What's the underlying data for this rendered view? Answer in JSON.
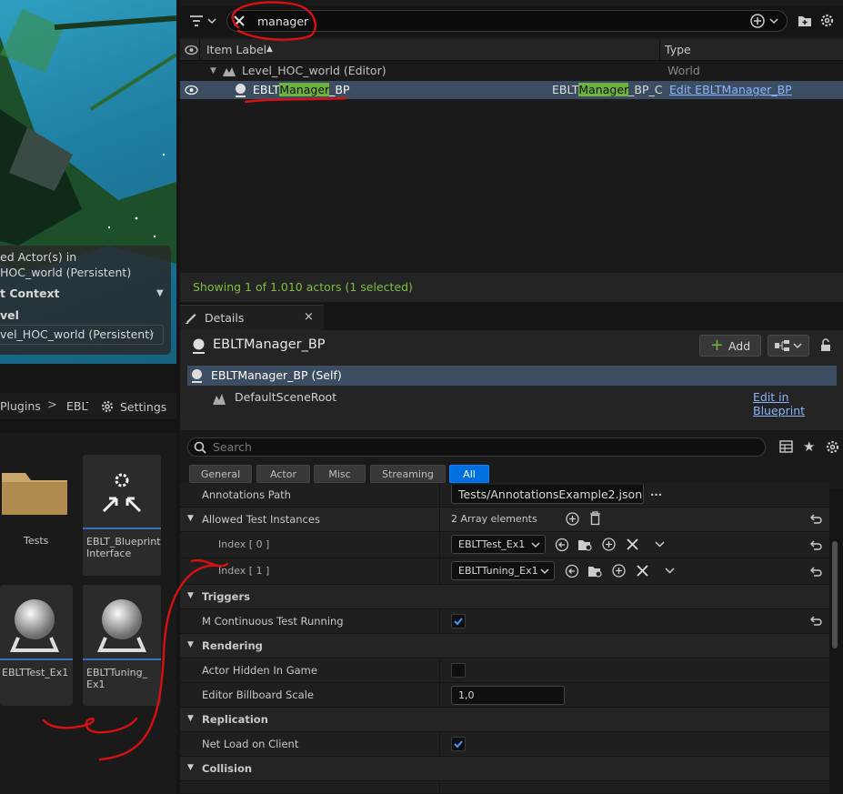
{
  "viewport": {
    "overlay_lines": [
      "ed Actor(s) in",
      "HOC_world (Persistent)",
      "t Context",
      "vel",
      "vel_HOC_world (Persistent)"
    ]
  },
  "content_browser": {
    "breadcrumb": [
      "Plugins",
      "EBLT"
    ],
    "settings_label": "Settings",
    "tiles": [
      {
        "label": "Tests",
        "icon": "folder-icon"
      },
      {
        "label": "EBLT_Blueprint Interface",
        "icon": "blueprint-interface-icon"
      },
      {
        "label": "EBLTTest_Ex1",
        "icon": "sphere-actor-icon"
      },
      {
        "label": "EBLTTuning_ Ex1",
        "icon": "sphere-actor-icon"
      }
    ]
  },
  "outliner": {
    "search_value": "manager",
    "columns": {
      "label": "Item Label",
      "type": "Type"
    },
    "rows": [
      {
        "label": "Level_HOC_world (Editor)",
        "type": "World"
      },
      {
        "label_pre": "EBLT",
        "label_hl": "Manager",
        "label_post": "_BP",
        "class_pre": "EBLT",
        "class_hl": "Manager",
        "class_post": "_BP_C",
        "type_link": "Edit EBLTManager_BP",
        "selected": true
      }
    ],
    "status": "Showing 1 of 1.010 actors (1 selected)",
    "highlight_color": "#6db33f"
  },
  "details": {
    "tab_label": "Details",
    "actor_name": "EBLTManager_BP",
    "add_label": "Add",
    "components": [
      {
        "label": "EBLTManager_BP (Self)",
        "selected": true
      },
      {
        "label": "DefaultSceneRoot"
      }
    ],
    "edit_blueprint_link": "Edit in Blueprint",
    "search_placeholder": "Search",
    "filters": [
      "General",
      "Actor",
      "Misc",
      "Streaming",
      "All"
    ],
    "active_filter": "All",
    "properties": {
      "annotations_path_label": "Annotations Path",
      "annotations_path_value": "Tests/AnnotationsExample2.json",
      "allowed_label": "Allowed Test Instances",
      "allowed_value": "2 Array elements",
      "index0_label": "Index [ 0 ]",
      "index0_value": "EBLTTest_Ex1",
      "index1_label": "Index [ 1 ]",
      "index1_value": "EBLTTuning_Ex1",
      "triggers": "Triggers",
      "continuous_label": "M Continuous Test Running",
      "continuous_checked": true,
      "rendering": "Rendering",
      "hidden_label": "Actor Hidden In Game",
      "hidden_checked": false,
      "billboard_label": "Editor Billboard Scale",
      "billboard_value": "1,0",
      "replication": "Replication",
      "netload_label": "Net Load on Client",
      "netload_checked": true,
      "collision": "Collision"
    }
  },
  "accent_color": "#0070e0"
}
